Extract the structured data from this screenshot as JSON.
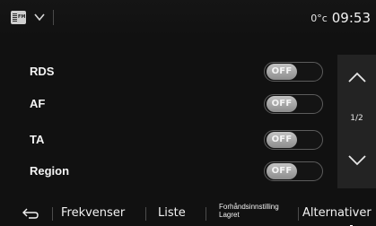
{
  "statusbar": {
    "source_icon": "fm-radio-icon",
    "source_icon_band": "FM",
    "source_chevron_icon": "chevron-down-icon",
    "outside_temp": "0°c",
    "clock": "09:53"
  },
  "settings": {
    "rows": [
      {
        "label": "RDS",
        "state": "OFF"
      },
      {
        "label": "AF",
        "state": "OFF"
      },
      {
        "label": "TA",
        "state": "OFF"
      },
      {
        "label": "Region",
        "state": "OFF"
      }
    ]
  },
  "scroll": {
    "up_icon": "chevron-up-icon",
    "down_icon": "chevron-down-icon",
    "page_indicator": "1/2"
  },
  "bottombar": {
    "back_icon": "back-arrow-icon",
    "frekvenser": "Frekvenser",
    "liste": "Liste",
    "forhandsinnstilling_line1": "Forhåndsinnstilling",
    "forhandsinnstilling_line2": "Lagret",
    "alternativer": "Alternativer"
  },
  "colors": {
    "background": "#111111",
    "panel": "#232323",
    "toggle_knob": "#a8a8a8",
    "text": "#f2f2f2"
  }
}
